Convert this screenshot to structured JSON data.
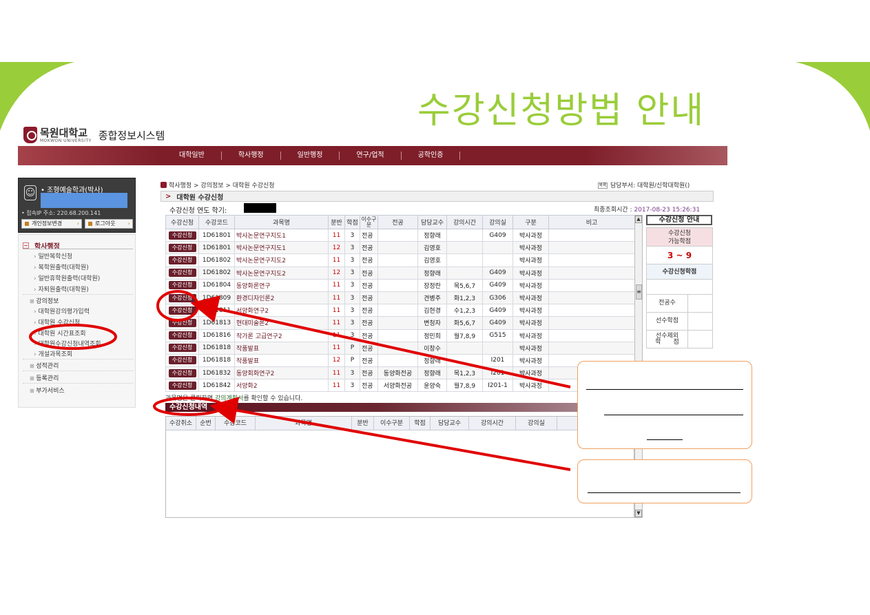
{
  "slide": {
    "title": "수강신청방법 안내"
  },
  "header": {
    "logo_kor": "목원대학교",
    "logo_eng": "MOKWON UNIVERSITY",
    "system_name": "종합정보시스템",
    "nav": [
      "대학일반",
      "학사행정",
      "일반행정",
      "연구/업적",
      "공학인증"
    ]
  },
  "user": {
    "dept": "• 조형예술학과(박사)",
    "ip": "• 접속IP 주소: 220.68.200.141",
    "btn_info": "개인정보변경",
    "btn_logout": "로그아웃"
  },
  "menu": {
    "head": "학사행정",
    "items_top": [
      "일반복학신청",
      "복학원출력(대학원)",
      "일반휴학원출력(대학원)",
      "자퇴원출력(대학원)"
    ],
    "group_lecture": "강의정보",
    "items_lecture": [
      "대학원강의평가입력",
      "대학원 수강신청",
      "대학원 시간표조회",
      "대학원수강신청내역조회",
      "개설과목조회"
    ],
    "groups_bottom": [
      "성적관리",
      "등록관리",
      "부가서비스"
    ]
  },
  "page": {
    "breadcrumb": "학사행정 > 강의정보 > 대학원 수강신청",
    "dept_icon": "목록",
    "dept_info": "담당부서: 대학원/신학대학원()",
    "section_title": "대학원 수강신청",
    "year_label": "수강신청 연도 학기:",
    "last_time_label": "최종조회시간 :",
    "last_time_value": "2017-08-23 15:26:31"
  },
  "grid": {
    "headers": [
      "수강신청",
      "수강코드",
      "과목명",
      "분반",
      "학점",
      "이수구분",
      "전공",
      "담당교수",
      "강의시간",
      "강의실",
      "구분",
      "비고"
    ],
    "button_label": "수강신청",
    "rows": [
      [
        "1D61801",
        "박사논문연구지도1",
        "11",
        "3",
        "전공",
        "",
        "정향래",
        "",
        "G409",
        "박사과정",
        ""
      ],
      [
        "1D61801",
        "박사논문연구지도1",
        "12",
        "3",
        "전공",
        "",
        "김영호",
        "",
        "",
        "박사과정",
        ""
      ],
      [
        "1D61802",
        "박사논문연구지도2",
        "11",
        "3",
        "전공",
        "",
        "김영호",
        "",
        "",
        "박사과정",
        ""
      ],
      [
        "1D61802",
        "박사논문연구지도2",
        "12",
        "3",
        "전공",
        "",
        "정향래",
        "",
        "G409",
        "박사과정",
        ""
      ],
      [
        "1D61804",
        "동양화론연구",
        "11",
        "3",
        "전공",
        "",
        "장정란",
        "목5,6,7",
        "G409",
        "박사과정",
        ""
      ],
      [
        "1D61809",
        "환경디자인론2",
        "11",
        "3",
        "전공",
        "",
        "견병주",
        "화1,2,3",
        "G306",
        "박사과정",
        ""
      ],
      [
        "1D61811",
        "서양화연구2",
        "11",
        "3",
        "전공",
        "",
        "김현경",
        "수1,2,3",
        "G409",
        "박사과정",
        ""
      ],
      [
        "1D61813",
        "현대미술론2",
        "11",
        "3",
        "전공",
        "",
        "변청자",
        "화5,6,7",
        "G409",
        "박사과정",
        ""
      ],
      [
        "1D61816",
        "작가론 고급연구2",
        "11",
        "3",
        "전공",
        "",
        "정민희",
        "월7,8,9",
        "G515",
        "박사과정",
        ""
      ],
      [
        "1D61818",
        "작품발표",
        "11",
        "P",
        "전공",
        "",
        "이창수",
        "",
        "",
        "박사과정",
        ""
      ],
      [
        "1D61818",
        "작품발표",
        "12",
        "P",
        "전공",
        "",
        "정향래",
        "",
        "I201",
        "박사과정",
        ""
      ],
      [
        "1D61832",
        "동양회화연구2",
        "11",
        "3",
        "전공",
        "동양화전공",
        "정향래",
        "목1,2,3",
        "I201",
        "박사과정",
        ""
      ],
      [
        "1D61842",
        "서양화2",
        "11",
        "3",
        "전공",
        "서양화전공",
        "윤양숙",
        "월7,8,9",
        "I201-1",
        "박사과정",
        ""
      ]
    ]
  },
  "notice": {
    "pre": "과목명을 클릭하면 ",
    "link": "강의계획서",
    "post": "를 확인할 수 있습니다."
  },
  "history": {
    "title": "수강신청내역",
    "headers": [
      "수강취소",
      "순번",
      "수강코드",
      "과목명",
      "분반",
      "이수구분",
      "학점",
      "담당교수",
      "강의시간",
      "강의실"
    ]
  },
  "right_panel": {
    "button": "수강신청 안내",
    "credit_head_1": "수강신청",
    "credit_head_2": "가능학점",
    "credit_value": "3 ~ 9",
    "applied": "수강신청학점",
    "major_count": "전공수",
    "prereq_credit": "선수학점",
    "prereq_exclude_1": "선수제외",
    "prereq_exclude_2": "학　　점"
  },
  "scroll": {
    "up": "▲",
    "down": "▼",
    "grip": "≡"
  },
  "colors": {
    "slide_green": "#9acd3a",
    "nav_maroon": "#7e1e29",
    "annotation_red": "#e00000",
    "callout_border": "#f0a060"
  }
}
